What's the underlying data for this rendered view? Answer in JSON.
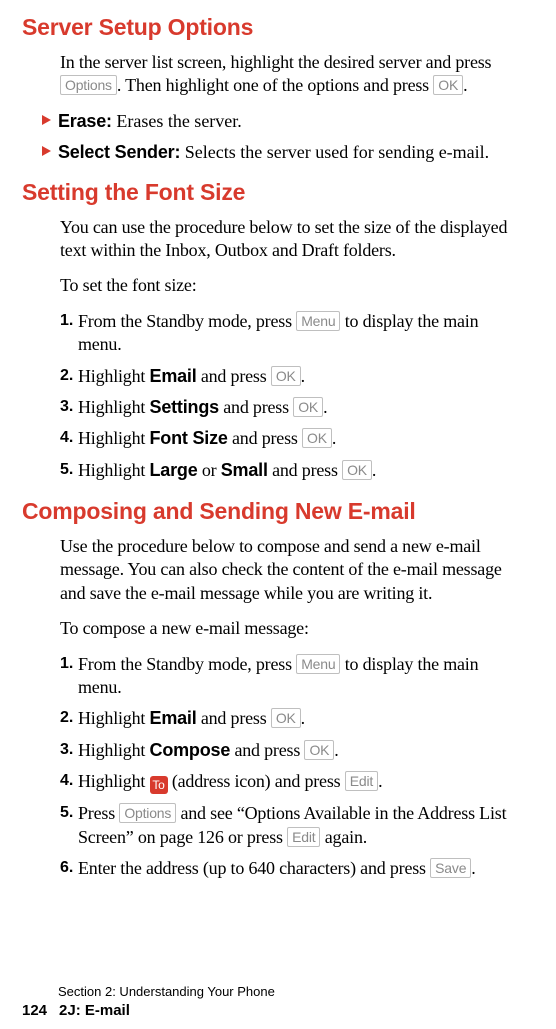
{
  "section1": {
    "title": "Server Setup Options",
    "intro_a": "In the server list screen, highlight the desired server and press ",
    "intro_b": ". Then highlight one of the options and press ",
    "intro_c": ".",
    "bullets": [
      {
        "label": "Erase:",
        "rest": " Erases the server."
      },
      {
        "label": "Select Sender:",
        "rest": " Selects the server used for sending e-mail."
      }
    ]
  },
  "keys": {
    "options": "Options",
    "ok": "OK",
    "menu": "Menu",
    "edit": "Edit",
    "save": "Save",
    "to": "To"
  },
  "section2": {
    "title": "Setting the Font Size",
    "intro": "You can use the procedure below to set the size of the displayed text within the Inbox, Outbox and Draft folders.",
    "lead": "To set the font size:",
    "steps": [
      {
        "num": "1.",
        "pre": "From the Standby mode, press ",
        "bold": "",
        "mid": "",
        "key": "menu",
        "post": " to display the main menu."
      },
      {
        "num": "2.",
        "pre": "Highlight ",
        "bold": "Email",
        "mid": " and press ",
        "key": "ok",
        "post": "."
      },
      {
        "num": "3.",
        "pre": "Highlight ",
        "bold": "Settings",
        "mid": " and press ",
        "key": "ok",
        "post": "."
      },
      {
        "num": "4.",
        "pre": "Highlight ",
        "bold": "Font Size",
        "mid": " and press ",
        "key": "ok",
        "post": "."
      },
      {
        "num": "5.",
        "pre": "Highlight ",
        "bold": "Large",
        "mid": " or ",
        "bold2": "Small",
        "mid2": " and press ",
        "key": "ok",
        "post": "."
      }
    ]
  },
  "section3": {
    "title": "Composing and Sending New E-mail",
    "intro": "Use the procedure below to compose and send a new e-mail message. You can also check the content of the e-mail message and save the e-mail message while you are writing it.",
    "lead": "To compose a new e-mail message:",
    "step1": {
      "num": "1.",
      "pre": "From the Standby mode, press ",
      "post": " to display the main menu."
    },
    "step2": {
      "num": "2.",
      "pre": "Highlight ",
      "bold": "Email",
      "mid": " and press ",
      "post": "."
    },
    "step3": {
      "num": "3.",
      "pre": "Highlight ",
      "bold": "Compose",
      "mid": " and press ",
      "post": "."
    },
    "step4": {
      "num": "4.",
      "pre": "Highlight ",
      "mid": " (address icon) and press ",
      "post": "."
    },
    "step5": {
      "num": "5.",
      "pre": "Press ",
      "mid": " and see “Options Available in the Address List Screen” on page 126 or press ",
      "post": " again."
    },
    "step6": {
      "num": "6.",
      "pre": "Enter the address (up to 640 characters) and press ",
      "post": "."
    }
  },
  "footer": {
    "line1": "Section 2: Understanding Your Phone",
    "page": "124",
    "crumb": "2J: E-mail"
  }
}
